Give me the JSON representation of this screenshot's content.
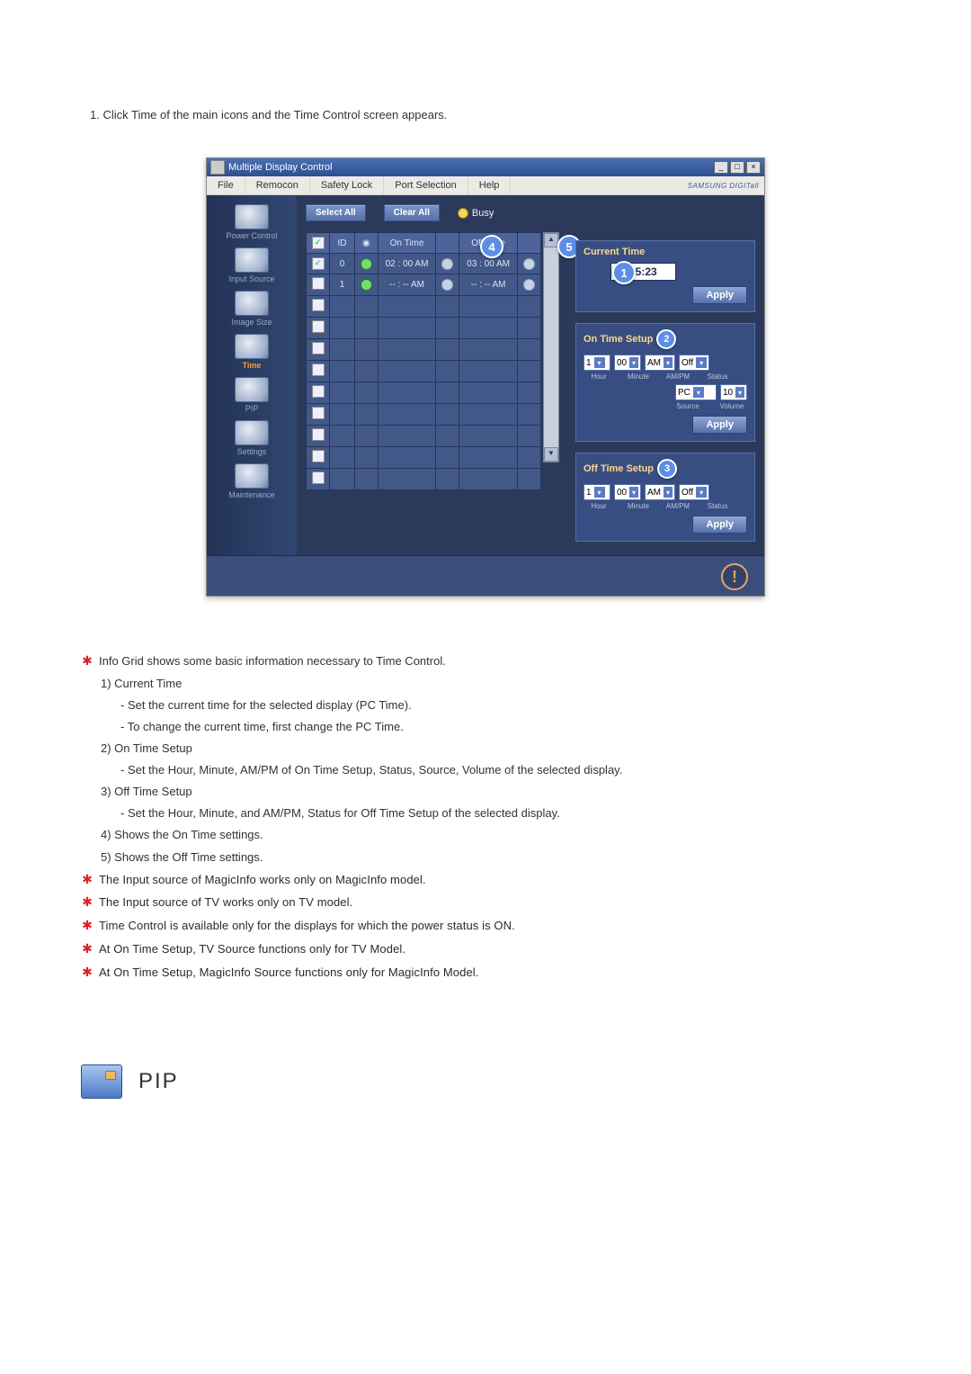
{
  "intro": "1.  Click Time of the main icons and the Time Control screen appears.",
  "window": {
    "title": "Multiple Display Control",
    "menu": [
      "File",
      "Remocon",
      "Safety Lock",
      "Port Selection",
      "Help"
    ],
    "brand": "SAMSUNG DIGITall"
  },
  "sidebar": [
    {
      "label": "Power Control"
    },
    {
      "label": "Input Source"
    },
    {
      "label": "Image Size"
    },
    {
      "label": "Time"
    },
    {
      "label": "PIP"
    },
    {
      "label": "Settings"
    },
    {
      "label": "Maintenance"
    }
  ],
  "buttons": {
    "select_all": "Select All",
    "clear_all": "Clear All"
  },
  "busy_label": "Busy",
  "grid": {
    "headers": {
      "id": "ID",
      "ontime": "On Time",
      "offtime": "Off Time"
    },
    "rows": [
      {
        "checked": true,
        "id": "0",
        "on_dot": "green",
        "ontime": "02 : 00 AM",
        "off_dot": "grey",
        "offtime": "03 : 00 AM",
        "off_extra": "grey"
      },
      {
        "checked": false,
        "id": "1",
        "on_dot": "green",
        "ontime": "-- : -- AM",
        "off_dot": "grey",
        "offtime": "-- : -- AM",
        "off_extra": "grey"
      },
      {
        "checked": false,
        "id": "",
        "on_dot": "",
        "ontime": "",
        "off_dot": "",
        "offtime": "",
        "off_extra": ""
      },
      {
        "checked": false,
        "id": "",
        "on_dot": "",
        "ontime": "",
        "off_dot": "",
        "offtime": "",
        "off_extra": ""
      },
      {
        "checked": false,
        "id": "",
        "on_dot": "",
        "ontime": "",
        "off_dot": "",
        "offtime": "",
        "off_extra": ""
      },
      {
        "checked": false,
        "id": "",
        "on_dot": "",
        "ontime": "",
        "off_dot": "",
        "offtime": "",
        "off_extra": ""
      },
      {
        "checked": false,
        "id": "",
        "on_dot": "",
        "ontime": "",
        "off_dot": "",
        "offtime": "",
        "off_extra": ""
      },
      {
        "checked": false,
        "id": "",
        "on_dot": "",
        "ontime": "",
        "off_dot": "",
        "offtime": "",
        "off_extra": ""
      },
      {
        "checked": false,
        "id": "",
        "on_dot": "",
        "ontime": "",
        "off_dot": "",
        "offtime": "",
        "off_extra": ""
      },
      {
        "checked": false,
        "id": "",
        "on_dot": "",
        "ontime": "",
        "off_dot": "",
        "offtime": "",
        "off_extra": ""
      },
      {
        "checked": false,
        "id": "",
        "on_dot": "",
        "ontime": "",
        "off_dot": "",
        "offtime": "",
        "off_extra": ""
      }
    ]
  },
  "current": {
    "title": "Current Time",
    "value": "05:23",
    "apply": "Apply"
  },
  "ontime": {
    "title": "On Time Setup",
    "hour": "1",
    "minute": "00",
    "ampm": "AM",
    "status": "Off",
    "source": "PC",
    "volume": "10",
    "labels": {
      "hour": "Hour",
      "minute": "Minute",
      "ampm": "AM/PM",
      "status": "Status",
      "source": "Source",
      "volume": "Volume"
    },
    "apply": "Apply"
  },
  "offtime": {
    "title": "Off Time Setup",
    "hour": "1",
    "minute": "00",
    "ampm": "AM",
    "status": "Off",
    "labels": {
      "hour": "Hour",
      "minute": "Minute",
      "ampm": "AM/PM",
      "status": "Status"
    },
    "apply": "Apply"
  },
  "badges": {
    "b1": "1",
    "b2": "2",
    "b3": "3",
    "b4": "4",
    "b5": "5"
  },
  "notes": {
    "l0": "Info Grid shows some basic information necessary to Time Control.",
    "l1": "1)  Current Time",
    "l1a": "- Set the current time for the selected display (PC Time).",
    "l1b": "- To change the current time, first change the PC Time.",
    "l2": "2)  On Time Setup",
    "l2a": "- Set the Hour, Minute, AM/PM of On Time Setup, Status, Source, Volume of the selected display.",
    "l3": "3)  Off Time Setup",
    "l3a": "- Set the Hour, Minute, and AM/PM, Status for Off Time Setup of the selected display.",
    "l4": "4)  Shows the On Time settings.",
    "l5": "5)  Shows the Off Time settings.",
    "s1": "The Input source of MagicInfo works only on MagicInfo model.",
    "s2": "The Input source of TV works only on TV model.",
    "s3": "Time Control is available only for the displays for which the power status is ON.",
    "s4": "At On Time Setup, TV Source functions only for TV Model.",
    "s5": "At On Time Setup, MagicInfo Source functions only for MagicInfo Model."
  },
  "pip_heading": "PIP"
}
